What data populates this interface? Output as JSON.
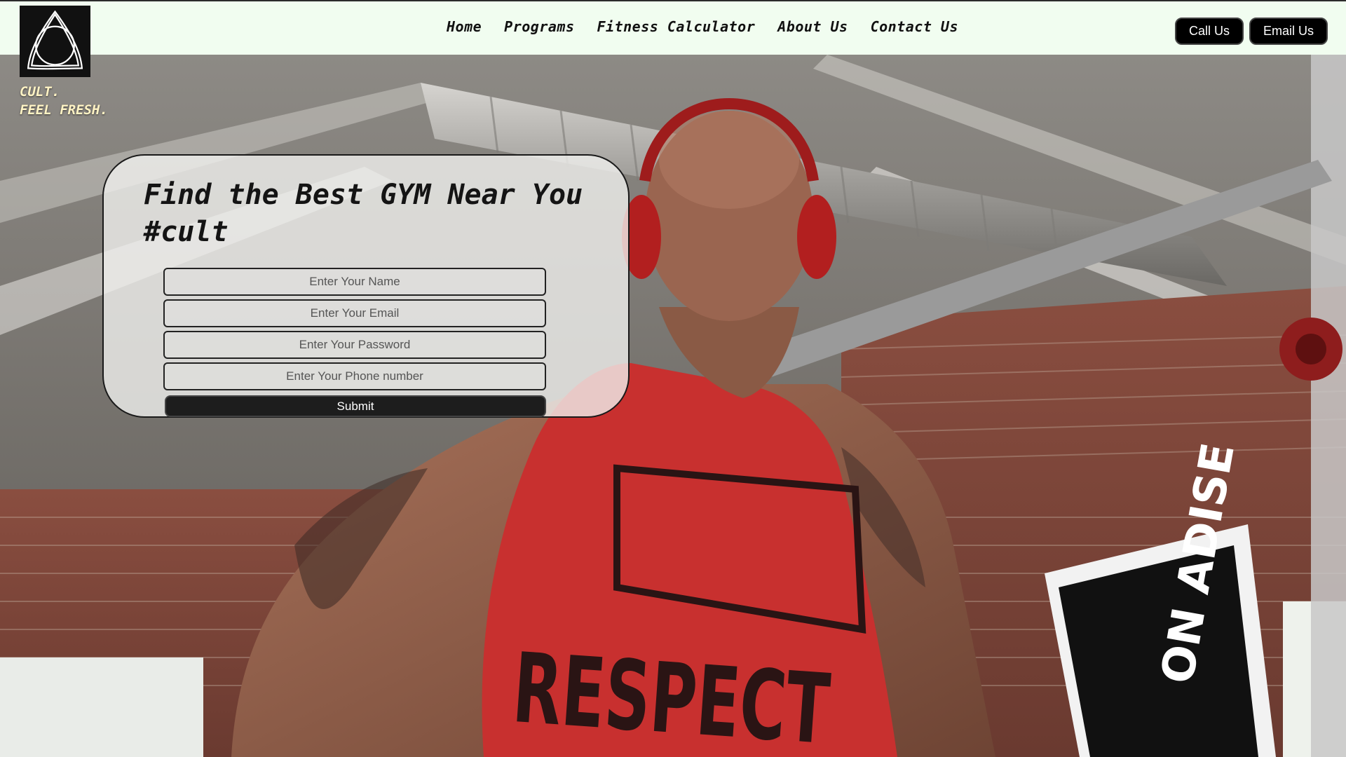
{
  "brand": {
    "logo_icon": "triquetra-knot-icon",
    "tagline_line1": "CULT.",
    "tagline_line2": "FEEL FRESH."
  },
  "nav": {
    "items": [
      {
        "label": "Home"
      },
      {
        "label": "Programs"
      },
      {
        "label": "Fitness Calculator"
      },
      {
        "label": "About Us"
      },
      {
        "label": "Contact Us"
      }
    ]
  },
  "header_buttons": {
    "call_label": "Call Us",
    "email_label": "Email Us"
  },
  "form": {
    "title_line1": "Find the Best GYM Near You",
    "title_line2": "#cult",
    "name_placeholder": "Enter Your Name",
    "email_placeholder": "Enter Your Email",
    "password_placeholder": "Enter Your Password",
    "phone_placeholder": "Enter Your Phone number",
    "submit_label": "Submit"
  },
  "hero": {
    "shirt_text": "RESPECT",
    "banner_text": "ON ADISE"
  },
  "colors": {
    "header_bg": "#f1fdf0",
    "button_bg": "#000000",
    "tagline": "#fff3c4",
    "shirt_red": "#c8302f"
  }
}
